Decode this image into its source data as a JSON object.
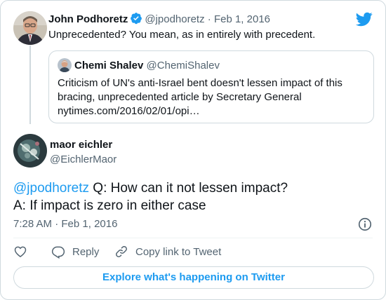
{
  "colors": {
    "accent": "#1d9bf0",
    "muted": "#536471",
    "text": "#0f1419",
    "border": "#cfd9de"
  },
  "parent": {
    "name": "John Podhoretz",
    "handle": "@jpodhoretz",
    "separator": "·",
    "date": "Feb 1, 2016",
    "text": "Unprecedented? You mean, as in entirely with precedent."
  },
  "quote": {
    "name": "Chemi Shalev",
    "handle": "@ChemiShalev",
    "text_line1": "Criticism of UN's anti-Israel bent doesn't lessen impact of this",
    "text_line2": "bracing, unprecedented article by Secretary General",
    "text_line3": "nytimes.com/2016/02/01/opi…"
  },
  "tweet": {
    "name": "maor eichler",
    "handle": "@EichlerMaor",
    "mention": "@jpodhoretz",
    "line1_rest": " Q: How can it not lessen impact?",
    "line2": "A: If impact is zero in either case",
    "time": "7:28 AM",
    "separator": "·",
    "date": "Feb 1, 2016"
  },
  "actions": {
    "reply_label": "Reply",
    "copy_label": "Copy link to Tweet"
  },
  "explore_label": "Explore what's happening on Twitter",
  "icons": [
    "twitter-bird-icon",
    "verified-badge-icon",
    "info-icon",
    "heart-icon",
    "reply-icon",
    "link-icon"
  ]
}
